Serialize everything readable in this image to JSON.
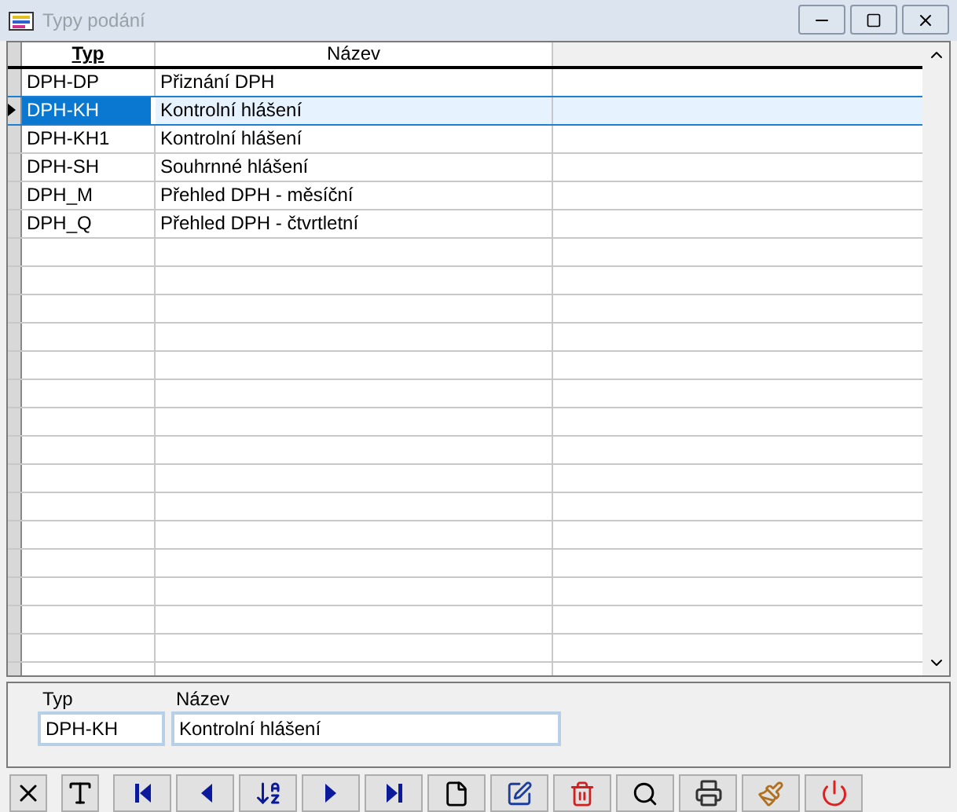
{
  "window": {
    "title": "Typy podání"
  },
  "table": {
    "columns": [
      {
        "label": "Typ",
        "sorted": true
      },
      {
        "label": "Název",
        "sorted": false
      }
    ],
    "rows": [
      {
        "typ": "DPH-DP",
        "nazev": "Přiznání DPH",
        "selected": false
      },
      {
        "typ": "DPH-KH",
        "nazev": "Kontrolní hlášení",
        "selected": true
      },
      {
        "typ": "DPH-KH1",
        "nazev": "Kontrolní hlášení",
        "selected": false
      },
      {
        "typ": "DPH-SH",
        "nazev": "Souhrnné hlášení",
        "selected": false
      },
      {
        "typ": "DPH_M",
        "nazev": "Přehled DPH - měsíční",
        "selected": false
      },
      {
        "typ": "DPH_Q",
        "nazev": "Přehled DPH - čtvrtletní",
        "selected": false
      }
    ]
  },
  "form": {
    "fields": [
      {
        "label": "Typ",
        "value": "DPH-KH"
      },
      {
        "label": "Název",
        "value": "Kontrolní hlášení"
      }
    ]
  },
  "toolbar": [
    {
      "kind": "cancel"
    },
    {
      "kind": "font"
    },
    {
      "kind": "first"
    },
    {
      "kind": "prev"
    },
    {
      "kind": "sort"
    },
    {
      "kind": "next"
    },
    {
      "kind": "last"
    },
    {
      "kind": "new"
    },
    {
      "kind": "edit"
    },
    {
      "kind": "delete"
    },
    {
      "kind": "find"
    },
    {
      "kind": "print"
    },
    {
      "kind": "tools"
    },
    {
      "kind": "exit"
    }
  ]
}
